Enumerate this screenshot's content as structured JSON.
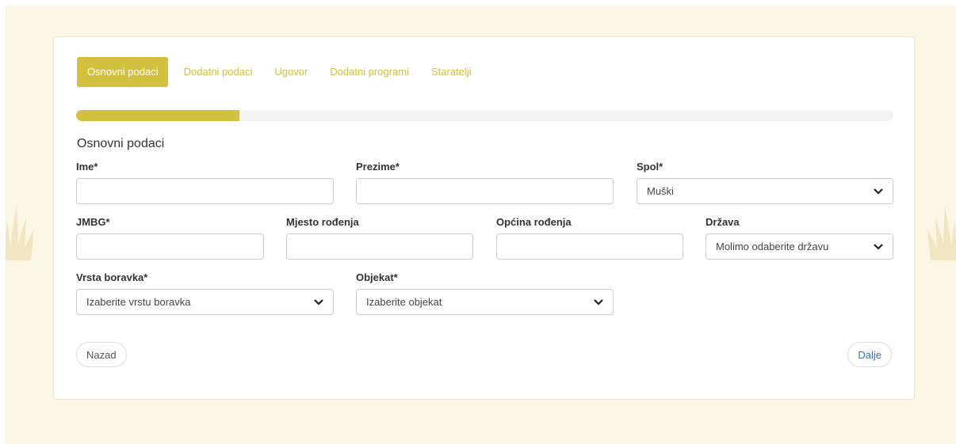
{
  "colors": {
    "accent": "#d4c13f",
    "tab_text": "#d3bf3c",
    "page_background": "#fcf6e4",
    "next_link": "#3b6fae"
  },
  "tabs": [
    {
      "label": "Osnovni podaci",
      "active": true
    },
    {
      "label": "Dodatni podaci",
      "active": false
    },
    {
      "label": "Ugovor",
      "active": false
    },
    {
      "label": "Dodatni programi",
      "active": false
    },
    {
      "label": "Staratelji",
      "active": false
    }
  ],
  "progress": {
    "percent": 20
  },
  "section": {
    "title": "Osnovni podaci"
  },
  "fields": {
    "ime": {
      "label": "Ime*",
      "value": ""
    },
    "prezime": {
      "label": "Prezime*",
      "value": ""
    },
    "spol": {
      "label": "Spol*",
      "selected": "Muški",
      "icon": "chevron-down-icon"
    },
    "jmbg": {
      "label": "JMBG*",
      "value": ""
    },
    "mjesto_rodjenja": {
      "label": "Mjesto rođenja",
      "value": ""
    },
    "opcina_rodjenja": {
      "label": "Općina rođenja",
      "value": ""
    },
    "drzava": {
      "label": "Država",
      "selected": "Molimo odaberite državu",
      "icon": "chevron-down-icon"
    },
    "vrsta_boravka": {
      "label": "Vrsta boravka*",
      "selected": "Izaberite vrstu boravka",
      "icon": "chevron-down-icon"
    },
    "objekat": {
      "label": "Objekat*",
      "selected": "Izaberite objekat",
      "icon": "chevron-down-icon"
    }
  },
  "buttons": {
    "back": "Nazad",
    "next": "Dalje"
  }
}
